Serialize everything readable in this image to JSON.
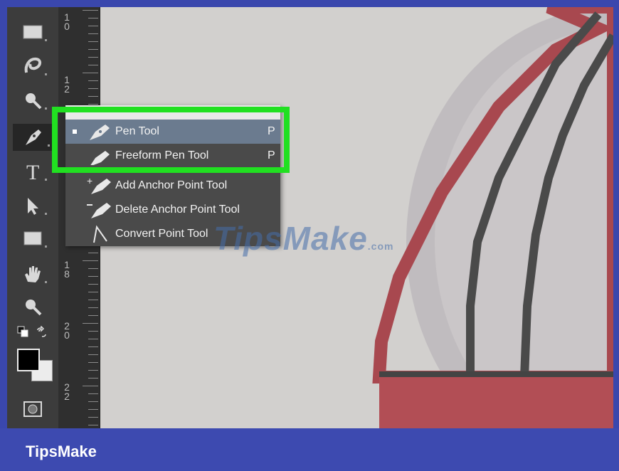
{
  "ruler": {
    "labels": [
      "1\n0",
      "1\n2",
      "1\n8",
      "2\n0",
      "2\n2"
    ]
  },
  "flyout": {
    "items": [
      {
        "label": "Pen Tool",
        "key": "P",
        "selected": true,
        "icon": "pen-icon"
      },
      {
        "label": "Freeform Pen Tool",
        "key": "P",
        "selected": false,
        "icon": "freeform-pen-icon"
      },
      {
        "label": "Add Anchor Point Tool",
        "key": "",
        "selected": false,
        "icon": "add-anchor-point-icon"
      },
      {
        "label": "Delete Anchor Point Tool",
        "key": "",
        "selected": false,
        "icon": "delete-anchor-point-icon"
      },
      {
        "label": "Convert Point Tool",
        "key": "",
        "selected": false,
        "icon": "convert-point-icon"
      }
    ]
  },
  "toolbar": {
    "tools": [
      "marquee-icon",
      "lasso-icon",
      "spot-healing-icon",
      "pen-icon",
      "type-icon",
      "path-selection-icon",
      "rectangle-icon",
      "hand-icon",
      "zoom-icon",
      "default-colors-icon",
      "swap-colors-icon",
      "color-swatches-icon",
      "quick-mask-icon"
    ]
  },
  "watermark": {
    "text": "TipsMake",
    "suffix": ".com"
  },
  "footer": {
    "brand": "TipsMake"
  },
  "colors": {
    "frame": "#3d4ab0",
    "highlight": "#21e021",
    "menu_selected": "#6b7b8f"
  }
}
